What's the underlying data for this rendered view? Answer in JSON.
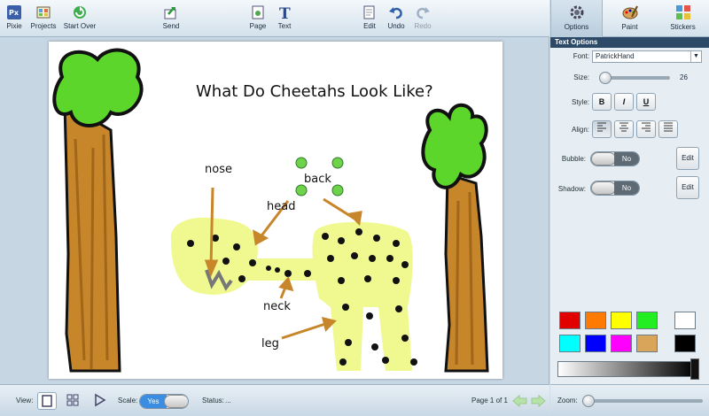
{
  "toolbar": {
    "pixie": "Pixie",
    "projects": "Projects",
    "start_over": "Start Over",
    "send": "Send",
    "page": "Page",
    "text": "Text",
    "edit": "Edit",
    "undo": "Undo",
    "redo": "Redo"
  },
  "panel_tabs": {
    "options": "Options",
    "paint": "Paint",
    "stickers": "Stickers"
  },
  "text_options": {
    "title": "Text Options",
    "font_label": "Font:",
    "font_value": "PatrickHand",
    "size_label": "Size:",
    "size_value": "26",
    "style_label": "Style:",
    "bold": "B",
    "italic": "I",
    "underline": "U",
    "align_label": "Align:",
    "bubble_label": "Bubble:",
    "bubble_value": "No",
    "shadow_label": "Shadow:",
    "shadow_value": "No",
    "edit_label": "Edit"
  },
  "palette": [
    "#e00000",
    "#ff7a00",
    "#ffff00",
    "#22ee22",
    "#ffffff",
    "#00ffff",
    "#0000ff",
    "#ff00ff",
    "#d9a55a",
    "#000000"
  ],
  "canvas": {
    "title": "What Do Cheetahs Look Like?",
    "labels": {
      "nose": "nose",
      "back": "back",
      "head": "head",
      "neck": "neck",
      "leg": "leg"
    }
  },
  "bottom": {
    "view_label": "View:",
    "scale_label": "Scale:",
    "scale_value": "Yes",
    "status_label": "Status:",
    "status_value": "...",
    "page_info": "Page 1 of 1",
    "zoom_label": "Zoom:"
  }
}
